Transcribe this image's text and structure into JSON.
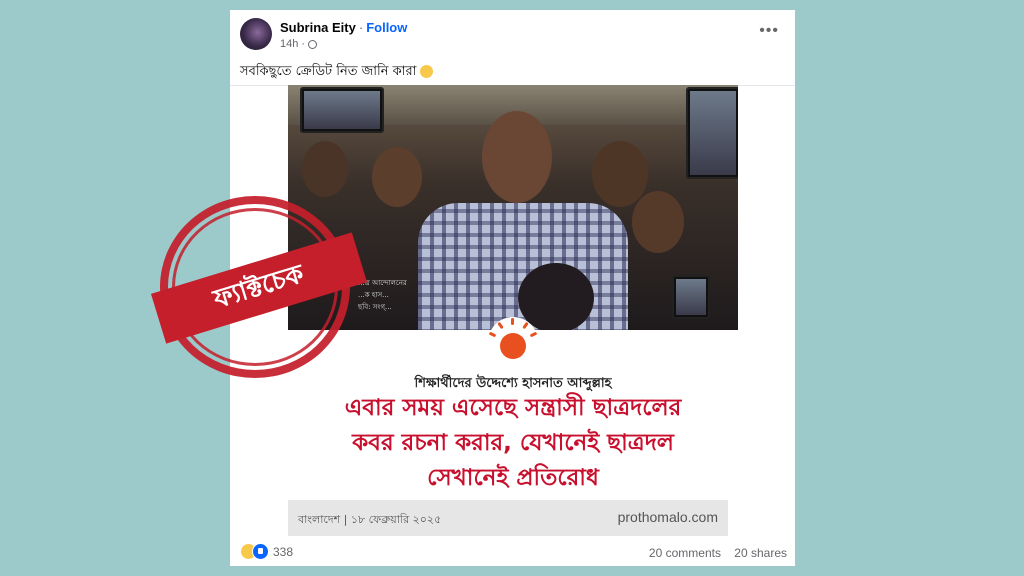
{
  "post": {
    "author": "Subrina Eity",
    "separator": "·",
    "follow_label": "Follow",
    "time": "14h ·",
    "more_label": "•••",
    "caption": "সবকিছুতে ক্রেডিট নিত জানি কারা"
  },
  "shared_image": {
    "photo_caption_line1": "...ত্র আন্দোলনের",
    "photo_caption_line2": "...ক হাস...",
    "photo_caption_line3": "ছবি: সংগ্...",
    "kicker": "শিক্ষার্থীদের উদ্দেশ্যে হাসনাত আব্দুল্লাহ",
    "headline_lines": [
      "এবার সময় এসেছে সন্ত্রাসী ছাত্রদলের",
      "কবর রচনা করার, যেখানেই ছাত্রদল",
      "সেখানেই প্রতিরোধ"
    ],
    "footer_left": "বাংলাদেশ | ১৮ ফেব্রুয়ারি ২০২৫",
    "footer_right": "prothomalo.com"
  },
  "engagement": {
    "reaction_count": "338",
    "comments": "20 comments",
    "shares": "20 shares"
  },
  "stamp": {
    "label": "ফ্যাক্টচেক"
  }
}
